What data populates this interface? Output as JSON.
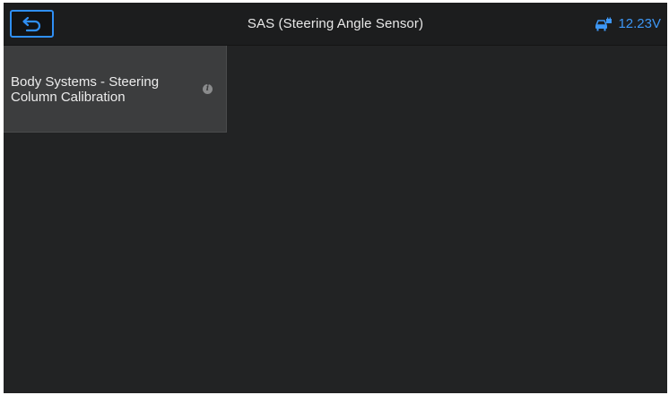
{
  "header": {
    "title": "SAS (Steering Angle Sensor)",
    "voltage": "12.23V",
    "back_icon": "back-arrow-icon",
    "battery_icon": "vehicle-battery-icon",
    "accent_color": "#2f8ff5"
  },
  "functions": [
    {
      "label": "Body Systems - Steering Column Calibration",
      "info_icon": "info-icon",
      "info_glyph": "i"
    }
  ]
}
